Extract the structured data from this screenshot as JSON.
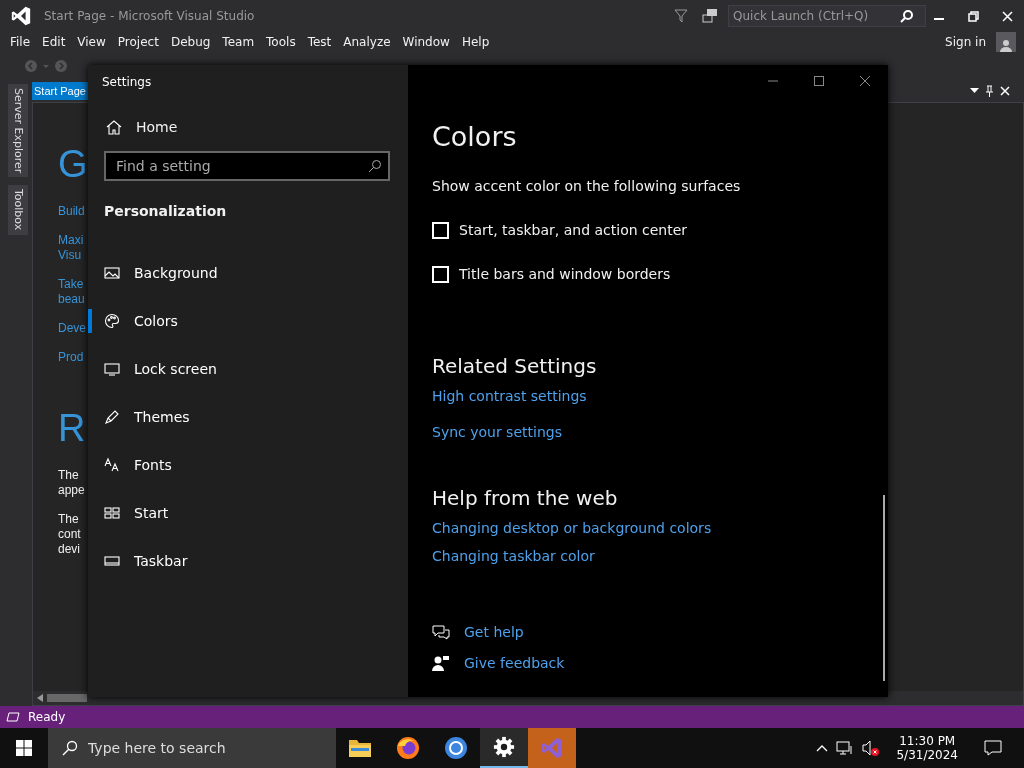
{
  "vs_window": {
    "title": "Start Page - Microsoft Visual Studio",
    "quick_launch": {
      "placeholder": "Quick Launch (Ctrl+Q)"
    },
    "menu": [
      "File",
      "Edit",
      "View",
      "Project",
      "Debug",
      "Team",
      "Tools",
      "Test",
      "Analyze",
      "Window",
      "Help"
    ],
    "sign_in": "Sign in",
    "side_tabs": [
      "Server Explorer",
      "Toolbox"
    ],
    "document_tab": {
      "label": "Start Page",
      "selected": true
    },
    "start_page": {
      "heading_1": "G",
      "links": [
        [
          "Build"
        ],
        [
          "Maxi",
          "Visu"
        ],
        [
          "Take",
          "beau"
        ],
        [
          "Deve"
        ],
        [
          "Prod"
        ]
      ],
      "heading_2": "R",
      "paragraphs": [
        [
          "The",
          "appe"
        ],
        [
          "The",
          "cont",
          "devi"
        ]
      ]
    },
    "status_bar": "Ready"
  },
  "settings": {
    "title": "Settings",
    "home": "Home",
    "search": {
      "placeholder": "Find a setting"
    },
    "section": "Personalization",
    "nav": [
      {
        "label": "Background",
        "kind": "picture",
        "selected": false
      },
      {
        "label": "Colors",
        "kind": "palette",
        "selected": true
      },
      {
        "label": "Lock screen",
        "kind": "monitor",
        "selected": false
      },
      {
        "label": "Themes",
        "kind": "brush",
        "selected": false
      },
      {
        "label": "Fonts",
        "kind": "fonts",
        "selected": false
      },
      {
        "label": "Start",
        "kind": "start",
        "selected": false
      },
      {
        "label": "Taskbar",
        "kind": "taskbar",
        "selected": false
      }
    ],
    "heading": "Colors",
    "subtitle": "Show accent color on the following surfaces",
    "checkboxes": [
      {
        "label": "Start, taskbar, and action center",
        "checked": false
      },
      {
        "label": "Title bars and window borders",
        "checked": false
      }
    ],
    "related": {
      "heading": "Related Settings",
      "links": [
        "High contrast settings",
        "Sync your settings"
      ]
    },
    "help": {
      "heading": "Help from the web",
      "links": [
        "Changing desktop or background colors",
        "Changing taskbar color"
      ]
    },
    "actions": [
      {
        "label": "Get help",
        "kind": "help"
      },
      {
        "label": "Give feedback",
        "kind": "feedback"
      }
    ]
  },
  "taskbar": {
    "search": {
      "placeholder": "Type here to search"
    },
    "apps": [
      {
        "kind": "folder",
        "selected": false
      },
      {
        "kind": "firefox",
        "selected": false
      },
      {
        "kind": "chrome",
        "selected": false
      },
      {
        "kind": "settings",
        "selected": true
      },
      {
        "kind": "vs",
        "selected": false
      }
    ],
    "time": "11:30 PM",
    "date": "5/31/2024"
  }
}
